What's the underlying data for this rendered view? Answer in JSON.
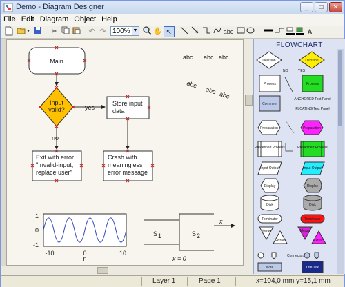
{
  "window": {
    "title": "Demo - Diagram Designer"
  },
  "menu": [
    "File",
    "Edit",
    "Diagram",
    "Object",
    "Help"
  ],
  "toolbar": {
    "zoom_value": "100%"
  },
  "diagram": {
    "main": "Main",
    "decision": "Input valid?",
    "yes": "yes",
    "no": "no",
    "store": "Store input data",
    "exit": "Exit with error \"Invalid-input, replace user\"",
    "crash": "Crash with meaningless error message",
    "abc": "abc",
    "plot_y_ticks": [
      "1",
      "0",
      "-1"
    ],
    "plot_x_ticks": [
      "-10",
      "0",
      "10"
    ],
    "plot_x_sub": "n",
    "s1": "S",
    "s1_sub": "1",
    "s2": "S",
    "s2_sub": "2",
    "x_label": "x",
    "eq_label": "x = 0"
  },
  "palette": {
    "title": "FLOWCHART",
    "items": [
      {
        "label": "Decision",
        "kind": "decision",
        "fill": "#ffffff"
      },
      {
        "label": "Decision",
        "kind": "decision",
        "fill": "#ffee00"
      },
      {
        "label": "NO",
        "kind": "caption"
      },
      {
        "label": "YES",
        "kind": "caption"
      },
      {
        "label": "Process",
        "kind": "process",
        "fill": "#ffffff"
      },
      {
        "label": "Process",
        "kind": "process",
        "fill": "#22dd22"
      },
      {
        "label": "Comment",
        "kind": "process",
        "fill": "#bcc9e8"
      },
      {
        "label": "ANCHORED Text Panel",
        "kind": "text"
      },
      {
        "label": "FLOATING Text Panel",
        "kind": "text"
      },
      {
        "label": "Preparation",
        "kind": "hexagon",
        "fill": "#ffffff"
      },
      {
        "label": "Preparation",
        "kind": "hexagon",
        "fill": "#ff22ff"
      },
      {
        "label": "Predefined Process",
        "kind": "predefined",
        "fill": "#ffffff"
      },
      {
        "label": "Predefined Process",
        "kind": "predefined",
        "fill": "#22dd22"
      },
      {
        "label": "Input Output",
        "kind": "io",
        "fill": "#ffffff"
      },
      {
        "label": "Input Output",
        "kind": "io",
        "fill": "#22eeff"
      },
      {
        "label": "Display",
        "kind": "display",
        "fill": "#ffffff"
      },
      {
        "label": "Display",
        "kind": "display",
        "fill": "#aaaaaa"
      },
      {
        "label": "Disk",
        "kind": "disk",
        "fill": "#ffffff"
      },
      {
        "label": "Disk",
        "kind": "disk",
        "fill": "#aaaaaa"
      },
      {
        "label": "Terminator",
        "kind": "terminator",
        "fill": "#ffffff"
      },
      {
        "label": "Terminator",
        "kind": "terminator",
        "fill": "#ff1111"
      },
      {
        "label": "Merge",
        "kind": "merge",
        "fill": "#ffffff"
      },
      {
        "label": "Extract",
        "kind": "extract",
        "fill": "#ffffff"
      },
      {
        "label": "Merge",
        "kind": "merge",
        "fill": "#dd22dd"
      },
      {
        "label": "Extract",
        "kind": "extract",
        "fill": "#ff22ff"
      },
      {
        "label": "Connectors",
        "kind": "caption"
      },
      {
        "label": "Note",
        "kind": "note",
        "fill": "#bcc9e8"
      },
      {
        "label": "Title Text",
        "kind": "title",
        "fill": "#1a2a8a"
      }
    ]
  },
  "status": {
    "layer": "Layer 1",
    "page": "Page 1",
    "coords": "x=104,0 mm  y=15,1 mm"
  }
}
